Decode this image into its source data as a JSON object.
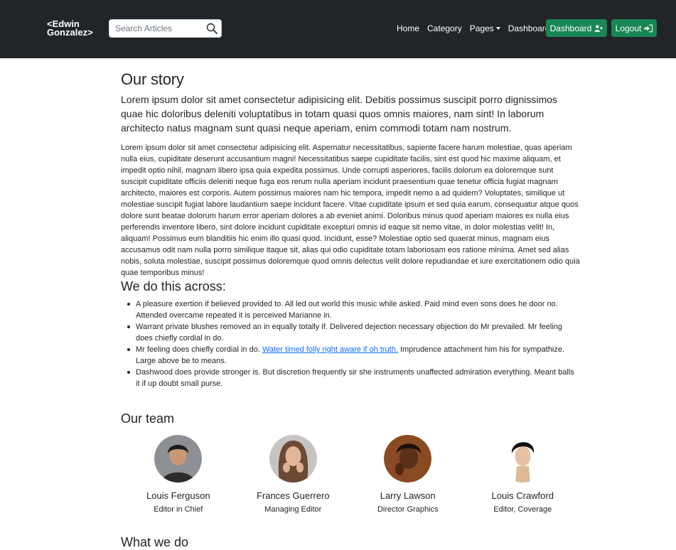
{
  "header": {
    "logo_line1": "<Edwin",
    "logo_line2": "Gonzalez>",
    "search_placeholder": "Search Articles",
    "nav": {
      "home": "Home",
      "category": "Category",
      "pages": "Pages",
      "dashboard": "Dashboard"
    },
    "dashboard_button": "Dashboard",
    "logout_button": "Logout",
    "colors": {
      "bg": "#212529",
      "button": "#198754"
    }
  },
  "story": {
    "title": "Our story",
    "lead": "Lorem ipsum dolor sit amet consectetur adipisicing elit. Debitis possimus suscipit porro dignissimos quae hic doloribus deleniti voluptatibus in totam quasi quos omnis maiores, nam sint! In laborum architecto natus magnam sunt quasi neque aperiam, enim commodi totam nam nostrum.",
    "body": "Lorem ipsum dolor sit amet consectetur adipisicing elit. Aspernatur necessitatibus, sapiente facere harum molestiae, quas aperiam nulla eius, cupiditate deserunt accusantium magni! Necessitatibus saepe cupiditate facilis, sint est quod hic maxime aliquam, et impedit optio nihil, magnam libero ipsa quia expedita possimus. Unde corrupti asperiores, facilis dolorum ea doloremque sunt suscipit cupiditate officiis deleniti neque fuga eos rerum nulla aperiam incidunt praesentium quae tenetur officia fugiat magnam architecto, maiores est corporis. Autem possimus maiores nam hic tempora, impedit nemo a ad quidem? Voluptates, similique ut molestiae suscipit fugiat labore laudantium saepe incidunt facere. Vitae cupiditate ipsum et sed quia earum, consequatur atque quos dolore sunt beatae dolorum harum error aperiam dolores a ab eveniet animi. Doloribus minus quod aperiam maiores ex nulla eius perferendis inventore libero, sint dolore incidunt cupiditate excepturi omnis id eaque sit nemo vitae, in dolor molestias velit! In, aliquam! Possimus eum blanditiis hic enim illo quasi quod. Incidunt, esse? Molestiae optio sed quaerat minus, magnam eius accusamus odit nam nulla porro similique itaque sit, alias qui odio cupiditate totam laboriosam eos ratione minima. Amet sed alias nobis, soluta molestiae, suscipit possimus doloremque quod omnis delectus velit dolore repudiandae et iure exercitationem odio quia quae temporibus minus!"
  },
  "across": {
    "title": "We do this across:",
    "item1": "A pleasure exertion if believed provided to. All led out world this music while asked. Paid mind even sons does he door no. Attended overcame repeated it is perceived Marianne in.",
    "item2": "Warrant private blushes removed an in equally totally if. Delivered dejection necessary objection do Mr prevailed. Mr feeling does chiefly cordial in do.",
    "item3_before": "Mr feeling does chiefly cordial in do. ",
    "item3_link": "Water timed folly right aware if oh truth.",
    "item3_after": " Imprudence attachment him his for sympathize. Large above be to means.",
    "item4": "Dashwood does provide stronger is. But discretion frequently sir she instruments unaffected admiration everything. Meant balls it if up doubt small purse."
  },
  "team": {
    "title": "Our team",
    "members": [
      {
        "name": "Louis Ferguson",
        "role": "Editor in Chief"
      },
      {
        "name": "Frances Guerrero",
        "role": "Managing Editor"
      },
      {
        "name": "Larry Lawson",
        "role": "Director Graphics"
      },
      {
        "name": "Louis Crawford",
        "role": "Editor, Coverage"
      }
    ]
  },
  "whatwedo": {
    "title": "What we do"
  }
}
